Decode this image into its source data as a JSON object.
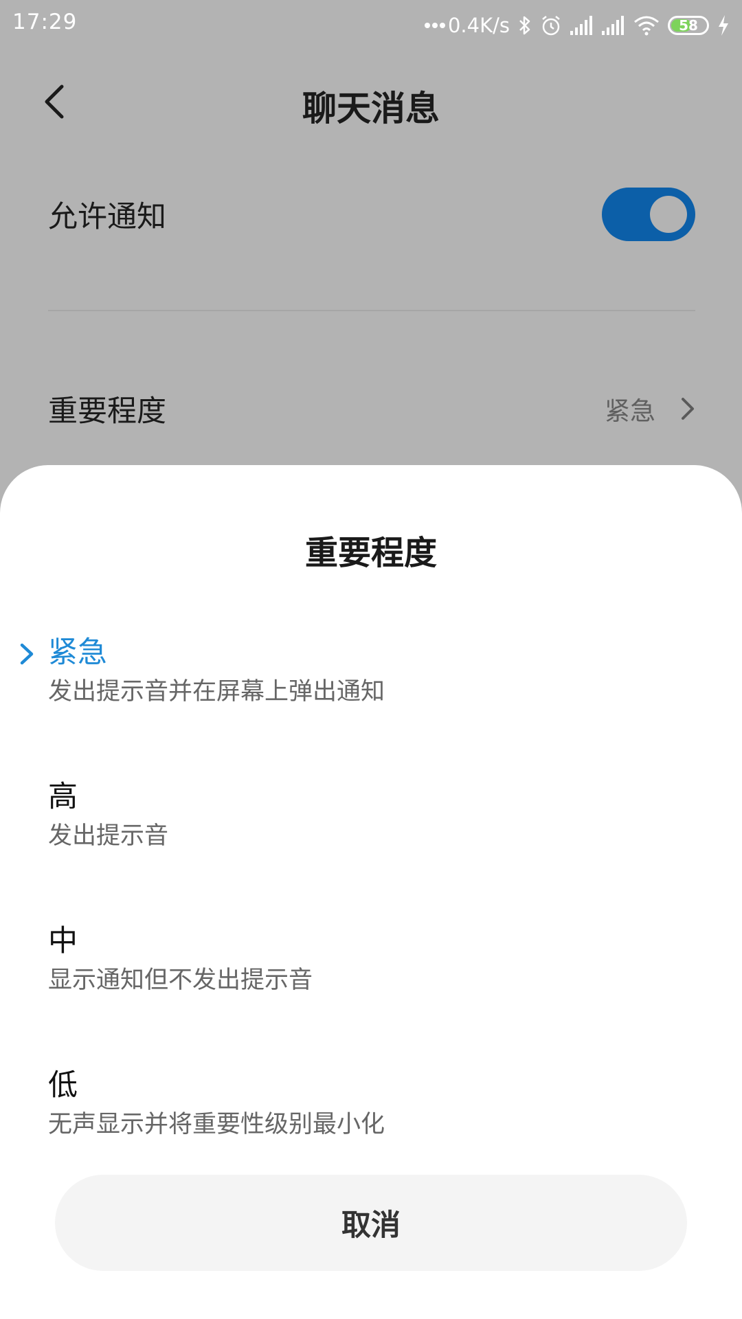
{
  "status_bar": {
    "time": "17:29",
    "network_speed": "0.4K/s",
    "battery_level": "58",
    "battery_fraction": 0.58,
    "icons": [
      "dots-icon",
      "bluetooth-icon",
      "alarm-icon",
      "signal-icon",
      "signal-icon",
      "wifi-icon",
      "battery-icon",
      "charging-icon"
    ],
    "battery_color": "#7dd35b"
  },
  "header": {
    "title": "聊天消息",
    "back_icon": "chevron-left-icon"
  },
  "settings": {
    "allow_notifications": {
      "label": "允许通知",
      "enabled": true,
      "toggle_color": "#0c5fa8"
    },
    "importance": {
      "label": "重要程度",
      "value": "紧急",
      "icon": "chevron-right-icon"
    }
  },
  "sheet": {
    "title": "重要程度",
    "accent_color": "#1f8ad6",
    "options": [
      {
        "label": "紧急",
        "description": "发出提示音并在屏幕上弹出通知",
        "selected": true
      },
      {
        "label": "高",
        "description": "发出提示音",
        "selected": false
      },
      {
        "label": "中",
        "description": "显示通知但不发出提示音",
        "selected": false
      },
      {
        "label": "低",
        "description": "无声显示并将重要性级别最小化",
        "selected": false
      }
    ],
    "cancel_label": "取消"
  }
}
